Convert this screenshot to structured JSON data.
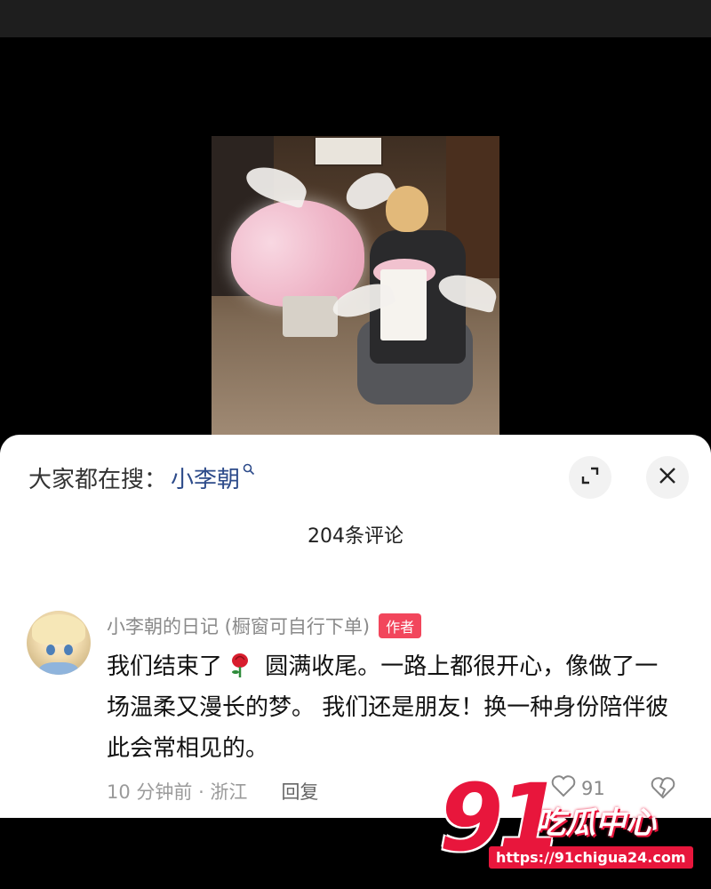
{
  "search": {
    "prefix": "大家都在搜：",
    "keyword": "小李朝"
  },
  "comments_header": {
    "count_label": "204条评论"
  },
  "comment": {
    "author": "小李朝的日记 (橱窗可自行下单)",
    "badge": "作者",
    "text_before_emoji": "我们结束了",
    "text_after_emoji": " 圆满收尾。一路上都很开心，像做了一场温柔又漫长的梦。 我们还是朋友！换一种身份陪伴彼此会常相见的。",
    "time_location": "10 分钟前 · 浙江",
    "reply_label": "回复",
    "like_count": "91"
  },
  "watermark": {
    "logo_number": "91",
    "logo_text": "吃瓜中心",
    "url": "https://91chigua24.com"
  },
  "icons": {
    "search": "magnifier-icon",
    "expand": "expand-icon",
    "close": "close-icon",
    "rose": "rose-emoji",
    "like": "heart-icon",
    "dislike": "broken-heart-icon"
  },
  "colors": {
    "keyword": "#2d4b8a",
    "badge": "#f2465c",
    "watermark": "#e8163c"
  }
}
